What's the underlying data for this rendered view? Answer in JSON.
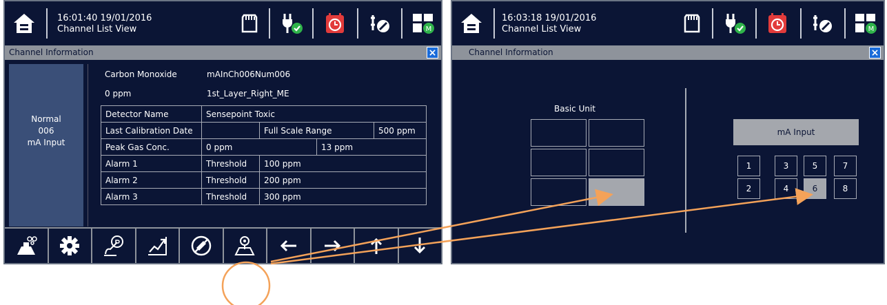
{
  "left": {
    "header": {
      "time": "16:01:40  19/01/2016",
      "view": "Channel List View"
    },
    "panel": {
      "title": "Channel Information",
      "close": "×"
    },
    "status": {
      "state": "Normal",
      "channel": "006",
      "type": "mA Input"
    },
    "info": {
      "gas": "Carbon Monoxide",
      "tag": "mAInCh006Num006",
      "reading": "0 ppm",
      "location": "1st_Layer_Right_ME"
    },
    "table": {
      "r1": {
        "label": "Detector Name",
        "value": "Sensepoint Toxic"
      },
      "r2": {
        "label": "Last Calibration Date",
        "value": "",
        "fs_label": "Full Scale Range",
        "fs_value": "500 ppm"
      },
      "r3": {
        "label": "Peak Gas Conc.",
        "value": "0 ppm",
        "extra": "13 ppm"
      },
      "r4": {
        "label": "Alarm 1",
        "type": "Threshold",
        "value": "100 ppm"
      },
      "r5": {
        "label": "Alarm 2",
        "type": "Threshold",
        "value": "200 ppm"
      },
      "r6": {
        "label": "Alarm 3",
        "type": "Threshold",
        "value": "300 ppm"
      }
    },
    "toolbar": [
      "gas-sensor-icon",
      "gear-icon",
      "calibration-icon",
      "trend-icon",
      "inhibit-icon",
      "location-icon",
      "arrow-left-icon",
      "arrow-right-icon",
      "arrow-up-icon",
      "arrow-down-icon"
    ]
  },
  "right": {
    "header": {
      "time": "16:03:18  19/01/2016",
      "view": "Channel List View"
    },
    "panel": {
      "title": "Channel Information",
      "close": "×"
    },
    "basic_unit": {
      "label": "Basic Unit",
      "selected_slot": 6
    },
    "ma_input": {
      "label": "mA Input",
      "channels": [
        "1",
        "3",
        "5",
        "7",
        "2",
        "4",
        "6",
        "8"
      ],
      "selected": "6"
    }
  },
  "colors": {
    "screen_bg": "#0b1535",
    "title_bar": "#8e939b",
    "selected": "#a4a7ad",
    "annotation": "#f4a259",
    "close_button": "#1a6bd9"
  }
}
